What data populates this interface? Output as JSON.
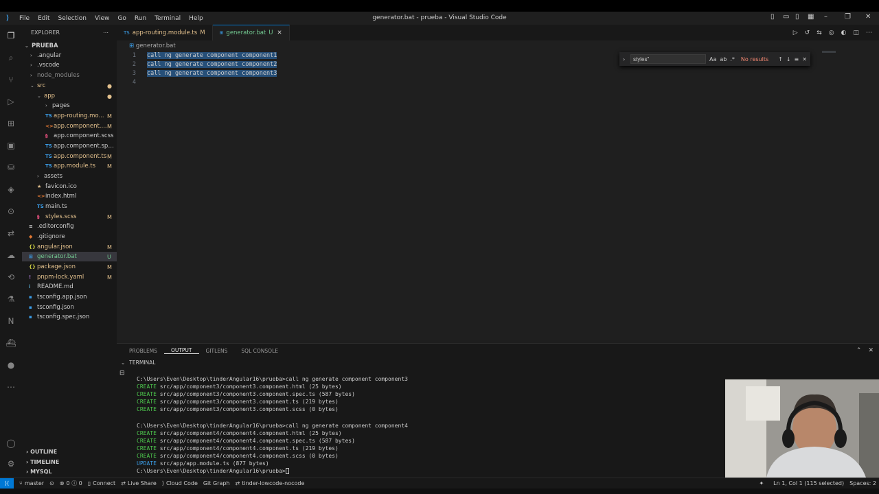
{
  "window": {
    "title": "generator.bat - prueba - Visual Studio Code"
  },
  "menu": [
    "File",
    "Edit",
    "Selection",
    "View",
    "Go",
    "Run",
    "Terminal",
    "Help"
  ],
  "sidebar": {
    "header": "EXPLORER",
    "root": "PRUEBA",
    "tree": [
      {
        "label": ".angular",
        "status": ""
      },
      {
        "label": ".vscode",
        "status": ""
      },
      {
        "label": "node_modules",
        "status": ""
      },
      {
        "label": "src",
        "status": ""
      },
      {
        "label": "app",
        "status": ""
      },
      {
        "label": "pages",
        "status": ""
      },
      {
        "label": "app-routing.mo...",
        "status": "M"
      },
      {
        "label": "app.component....",
        "status": "M"
      },
      {
        "label": "app.component.scss",
        "status": ""
      },
      {
        "label": "app.component.spec.ts",
        "status": ""
      },
      {
        "label": "app.component.ts",
        "status": "M"
      },
      {
        "label": "app.module.ts",
        "status": "M"
      },
      {
        "label": "assets",
        "status": ""
      },
      {
        "label": "favicon.ico",
        "status": ""
      },
      {
        "label": "index.html",
        "status": ""
      },
      {
        "label": "main.ts",
        "status": ""
      },
      {
        "label": "styles.scss",
        "status": "M"
      },
      {
        "label": ".editorconfig",
        "status": ""
      },
      {
        "label": ".gitignore",
        "status": ""
      },
      {
        "label": "angular.json",
        "status": "M"
      },
      {
        "label": "generator.bat",
        "status": "U"
      },
      {
        "label": "package.json",
        "status": "M"
      },
      {
        "label": "pnpm-lock.yaml",
        "status": "M"
      },
      {
        "label": "README.md",
        "status": ""
      },
      {
        "label": "tsconfig.app.json",
        "status": ""
      },
      {
        "label": "tsconfig.json",
        "status": ""
      },
      {
        "label": "tsconfig.spec.json",
        "status": ""
      }
    ],
    "sections": [
      "OUTLINE",
      "TIMELINE",
      "MYSQL"
    ]
  },
  "tabs": [
    {
      "label": "app-routing.module.ts",
      "status": "M",
      "icon": "TS"
    },
    {
      "label": "generator.bat",
      "status": "U",
      "icon": "bat"
    }
  ],
  "editor": {
    "breadcrumb": "generator.bat",
    "lines": [
      {
        "n": "1",
        "text": "call ng generate component component1"
      },
      {
        "n": "2",
        "text": "call ng generate component component2"
      },
      {
        "n": "3",
        "text": "call ng generate component component3"
      },
      {
        "n": "4",
        "text": ""
      }
    ]
  },
  "find": {
    "value": "styles\"",
    "results": "No results"
  },
  "panel": {
    "tabs": [
      "PROBLEMS",
      "OUTPUT",
      "GITLENS",
      "SQL CONSOLE"
    ],
    "active_tab": "OUTPUT",
    "section": "TERMINAL",
    "lines": [
      {
        "kw": "",
        "text": "C:\\Users\\Even\\Desktop\\tinderAngular16\\prueba>call ng generate component component3"
      },
      {
        "kw": "CREATE",
        "text": " src/app/component3/component3.component.html (25 bytes)"
      },
      {
        "kw": "CREATE",
        "text": " src/app/component3/component3.component.spec.ts (587 bytes)"
      },
      {
        "kw": "CREATE",
        "text": " src/app/component3/component3.component.ts (219 bytes)"
      },
      {
        "kw": "CREATE",
        "text": " src/app/component3/component3.component.scss (0 bytes)"
      },
      {
        "kw": "",
        "text": ""
      },
      {
        "kw": "",
        "text": "C:\\Users\\Even\\Desktop\\tinderAngular16\\prueba>call ng generate component component4"
      },
      {
        "kw": "CREATE",
        "text": " src/app/component4/component4.component.html (25 bytes)"
      },
      {
        "kw": "CREATE",
        "text": " src/app/component4/component4.component.spec.ts (587 bytes)"
      },
      {
        "kw": "CREATE",
        "text": " src/app/component4/component4.component.ts (219 bytes)"
      },
      {
        "kw": "CREATE",
        "text": " src/app/component4/component4.component.scss (0 bytes)"
      },
      {
        "kw": "UPDATE",
        "text": " src/app/app.module.ts (877 bytes)"
      },
      {
        "kw": "",
        "text": "C:\\Users\\Even\\Desktop\\tinderAngular16\\prueba>"
      }
    ]
  },
  "status": {
    "branch": "master",
    "problems": "0 ⓘ 0",
    "connect": "Connect",
    "live_share": "Live Share",
    "cloud_code": "Cloud Code",
    "git_graph": "Git Graph",
    "project": "tinder-lowcode-nocode",
    "cursor": "Ln 1, Col 1 (115 selected)",
    "spaces": "Spaces: 2"
  }
}
